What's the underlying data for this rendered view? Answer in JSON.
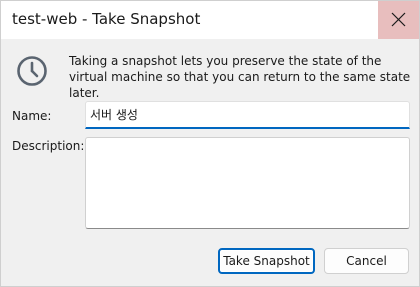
{
  "window": {
    "title": "test-web - Take Snapshot",
    "close_icon": "close-icon"
  },
  "info": {
    "icon": "clock-icon",
    "text": "Taking a snapshot lets you preserve the state of the virtual machine so that you can return to the same state later."
  },
  "form": {
    "name_label": "Name:",
    "name_value": "서버 생성",
    "description_label": "Description:",
    "description_value": ""
  },
  "buttons": {
    "take_snapshot": "Take Snapshot",
    "cancel": "Cancel"
  },
  "colors": {
    "accent": "#0067c0",
    "close_hover_bg": "#e8bebe"
  }
}
